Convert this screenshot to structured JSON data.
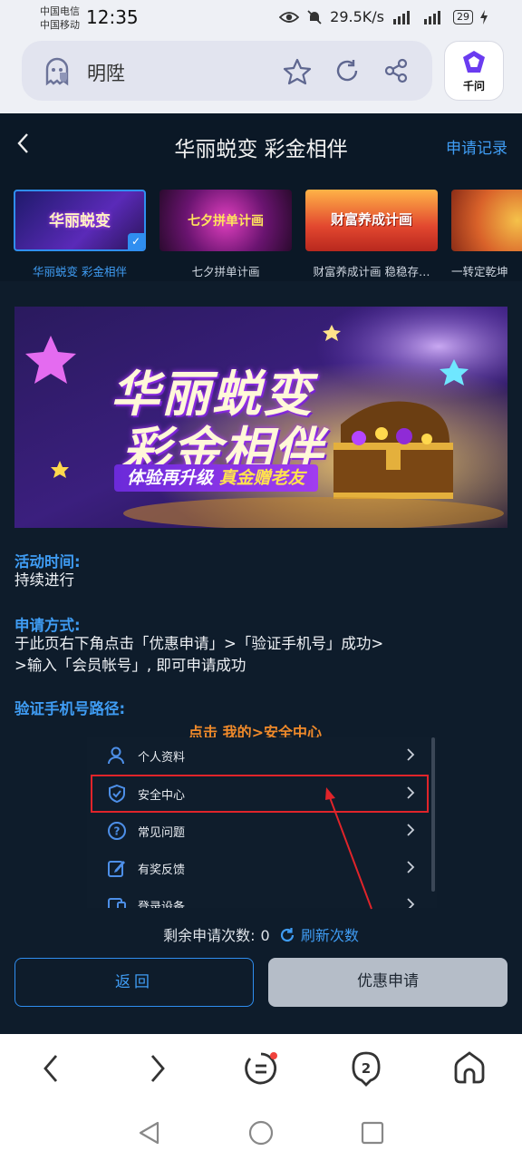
{
  "status_bar": {
    "carrier1": "中国电信",
    "carrier2": "中国移动",
    "time": "12:35",
    "speed": "29.5K/s",
    "battery": "29"
  },
  "browser": {
    "url_text": "明陞",
    "qianwen_label": "千问"
  },
  "header": {
    "title": "华丽蜕变 彩金相伴",
    "records": "申请记录"
  },
  "tabs": [
    {
      "label": "华丽蜕变 彩金相伴",
      "thumb_text": "华丽蜕变"
    },
    {
      "label": "七夕拼单计画",
      "thumb_text": "七夕拼单计画"
    },
    {
      "label": "财富养成计画 稳稳存…",
      "thumb_text": "财富养成计画"
    },
    {
      "label": "一转定乾坤",
      "thumb_text": ""
    }
  ],
  "banner": {
    "line1": "华丽蜕变",
    "line2": "彩金相伴",
    "sub_a": "体验再升级",
    "sub_b": "真金赠老友"
  },
  "content": {
    "time_label": "活动时间:",
    "time_value": "持续进行",
    "method_label": "申请方式:",
    "method_line1": "于此页右下角点击「优惠申请」>「验证手机号」成功>",
    "method_line2": ">输入「会员帐号」, 即可申请成功",
    "path_label": "验证手机号路径:",
    "hint": "点击 我的>安全中心"
  },
  "mini_menu": [
    {
      "label": "个人资料",
      "icon": "user-icon"
    },
    {
      "label": "安全中心",
      "icon": "shield-icon"
    },
    {
      "label": "常见问题",
      "icon": "question-icon"
    },
    {
      "label": "有奖反馈",
      "icon": "edit-icon"
    },
    {
      "label": "登录设备",
      "icon": "device-icon"
    }
  ],
  "remaining": {
    "label": "剩余申请次数:",
    "count": "0",
    "refresh": "刷新次数"
  },
  "buttons": {
    "back": "返回",
    "apply": "优惠申请"
  },
  "colors": {
    "accent": "#3f9cf3",
    "background": "#0e1c2b",
    "highlight_box": "#e0242a",
    "hint": "#f08a2a"
  }
}
